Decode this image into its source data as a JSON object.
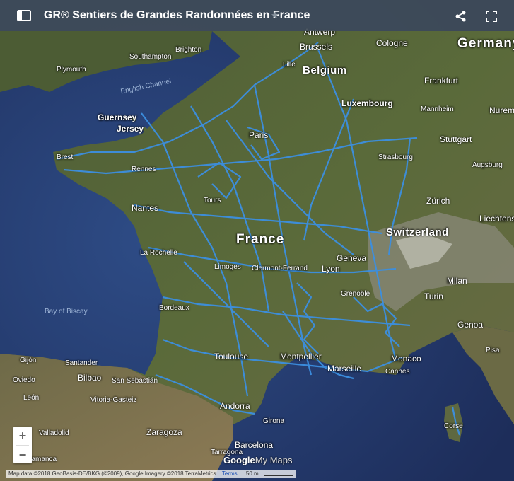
{
  "header": {
    "title": "GR® Sentiers de Grandes Randonnées en France",
    "star": "★",
    "share_icon": "share-icon",
    "fullscreen_icon": "fullscreen-icon",
    "menu_icon": "sidebar-toggle-icon"
  },
  "map": {
    "labels": {
      "antwerp": "Antwerp",
      "brussels": "Brussels",
      "cologne": "Cologne",
      "germany": "Germany",
      "southampton": "Southampton",
      "brighton": "Brighton",
      "plymouth": "Plymouth",
      "lille": "Lille",
      "belgium": "Belgium",
      "english_channel": "English Channel",
      "frankfurt": "Frankfurt",
      "luxembourg": "Luxembourg",
      "mannheim": "Mannheim",
      "nuremberg": "Nurem",
      "guernsey": "Guernsey",
      "jersey": "Jersey",
      "paris": "Paris",
      "stuttgart": "Stuttgart",
      "brest": "Brest",
      "rennes": "Rennes",
      "strasbourg": "Strasbourg",
      "augsburg": "Augsburg",
      "tours": "Tours",
      "nantes": "Nantes",
      "zurich": "Zürich",
      "liechtenstein": "Liechtenste",
      "switzerland": "Switzerland",
      "france": "France",
      "la_rochelle": "La Rochelle",
      "geneva": "Geneva",
      "limoges": "Limoges",
      "clermont": "Clermont-Ferrand",
      "lyon": "Lyon",
      "milan": "Milan",
      "bay_of_biscay": "Bay of Biscay",
      "grenoble": "Grenoble",
      "turin": "Turin",
      "bordeaux": "Bordeaux",
      "genoa": "Genoa",
      "toulouse": "Toulouse",
      "montpellier": "Montpellier",
      "monaco": "Monaco",
      "pisa": "Pisa",
      "gijon": "Gijón",
      "santander": "Santander",
      "marseille": "Marseille",
      "cannes": "Cannes",
      "oviedo": "Oviedo",
      "bilbao": "Bilbao",
      "san_sebastian": "San Sebastián",
      "leon": "León",
      "vitoria": "Vitoria-Gasteiz",
      "andorra": "Andorra",
      "girona": "Girona",
      "valladolid": "Valladolid",
      "zaragoza": "Zaragoza",
      "corse": "Corse",
      "barcelona": "Barcelona",
      "tarragona": "Tarragona",
      "salamanca": "Salamanca"
    }
  },
  "controls": {
    "zoom_in": "+",
    "zoom_out": "−"
  },
  "footer": {
    "attribution": "Map data ©2018 GeoBasis-DE/BKG (©2009), Google Imagery ©2018 TerraMetrics",
    "terms": "Terms",
    "scale": "50 mi",
    "logo_google": "Google",
    "logo_mymaps": "My Maps"
  },
  "colors": {
    "trail": "#3c8fe0",
    "header_bg": "#404c58",
    "sea": "#24396b",
    "land": "#4a5a32"
  }
}
